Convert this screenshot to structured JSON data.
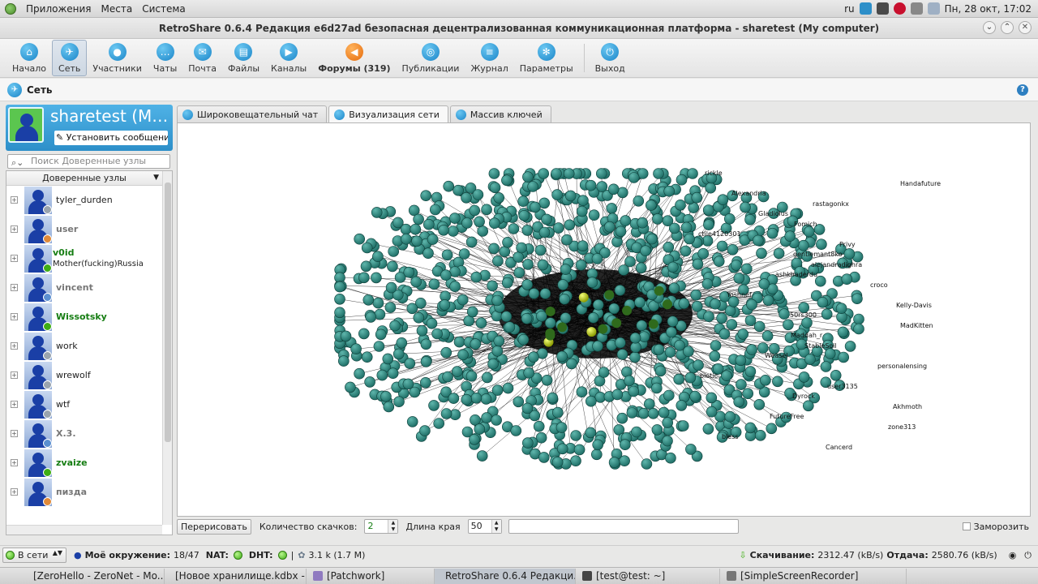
{
  "panel": {
    "menus": [
      "Приложения",
      "Места",
      "Система"
    ],
    "lang": "ru",
    "datetime": "Пн, 28 окт, 17:02"
  },
  "window": {
    "title": "RetroShare 0.6.4 Редакция e6d27ad безопасная децентрализованная коммуникационная платформа - sharetest (My computer)"
  },
  "toolbar": {
    "items": [
      {
        "label": "Начало",
        "icon": "home-icon"
      },
      {
        "label": "Сеть",
        "icon": "network-icon",
        "active": true
      },
      {
        "label": "Участники",
        "icon": "people-icon"
      },
      {
        "label": "Чаты",
        "icon": "chat-icon"
      },
      {
        "label": "Почта",
        "icon": "mail-icon"
      },
      {
        "label": "Файлы",
        "icon": "files-icon"
      },
      {
        "label": "Каналы",
        "icon": "channels-icon"
      },
      {
        "label": "Форумы (319)",
        "icon": "forums-icon",
        "bold": true
      },
      {
        "label": "Публикации",
        "icon": "posted-icon"
      },
      {
        "label": "Журнал",
        "icon": "log-icon"
      },
      {
        "label": "Параметры",
        "icon": "settings-icon"
      },
      {
        "label": "Выход",
        "icon": "power-icon"
      }
    ]
  },
  "page": {
    "title": "Сеть",
    "help": "?"
  },
  "profile": {
    "name": "sharetest (M…",
    "status_placeholder": "Установить сообщение с"
  },
  "search": {
    "placeholder": "Поиск Доверенные узлы"
  },
  "nodes": {
    "header": "Доверенные узлы",
    "items": [
      {
        "name": "tyler_durden",
        "state": "plain",
        "badge": "#9aa4ae"
      },
      {
        "name": "user",
        "state": "offline",
        "badge": "#e08a3a"
      },
      {
        "name": "v0id",
        "sub": "Mother(fucking)Russia",
        "state": "online",
        "badge": "#3fae15"
      },
      {
        "name": "vincent",
        "state": "offline",
        "badge": "#5a8fd0"
      },
      {
        "name": "Wissotsky",
        "state": "online",
        "badge": "#3fae15"
      },
      {
        "name": "work",
        "state": "plain",
        "badge": "#9aa4ae"
      },
      {
        "name": "wrewolf",
        "state": "plain",
        "badge": "#9aa4ae"
      },
      {
        "name": "wtf",
        "state": "plain",
        "badge": "#9aa4ae"
      },
      {
        "name": "X.3.",
        "state": "offline",
        "badge": "#5a8fd0"
      },
      {
        "name": "zvaize",
        "state": "online",
        "badge": "#3fae15"
      },
      {
        "name": "пизда",
        "state": "offline",
        "badge": "#e08a3a"
      }
    ]
  },
  "tabs": [
    {
      "label": "Широковещательный чат",
      "active": false
    },
    {
      "label": "Визуализация сети",
      "active": true
    },
    {
      "label": "Массив ключей",
      "active": false
    }
  ],
  "graph_labels": [
    "rickle",
    "Handafuture",
    "Alexandria",
    "rastagonkx",
    "Gladiolus",
    "Fomich",
    "ctile4120301",
    "Privy",
    "gentlemant8ko",
    "alejandradighra",
    "ashkhaderdu",
    "croco",
    "Yoshnef",
    "Kelly-Davis",
    "50rs300",
    "MadKitten",
    "Maddah_r",
    "StableSoil",
    "Weasel",
    "personalensing",
    "biotic",
    "user3135",
    "Dyrock",
    "Akhmoth",
    "FutureFree",
    "zone313",
    "bless",
    "Cancerd"
  ],
  "controls": {
    "redraw": "Перерисовать",
    "hops_label": "Количество скачков:",
    "hops_value": "2",
    "edge_label": "Длина края",
    "edge_value": "50",
    "freeze": "Заморозить"
  },
  "status": {
    "net_state": "В сети",
    "neighborhood_label": "Моё окружение:",
    "neighborhood_value": "18/47",
    "nat_label": "NAT:",
    "dht_label": "DHT:",
    "dht_peers": "3.1 k (1.7 M)",
    "download_label": "Скачивание:",
    "download_value": "2312.47 (kB/s)",
    "upload_label": "Отдача:",
    "upload_value": "2580.76 (kB/s)"
  },
  "taskbar": [
    {
      "label": "[ZeroHello - ZeroNet - Mo...",
      "color": "#e07a3a"
    },
    {
      "label": "[Новое хранилище.kdbx - ...",
      "color": "#6aa84f"
    },
    {
      "label": "[Patchwork]",
      "color": "#8f7ac0"
    },
    {
      "label": "RetroShare 0.6.4 Редакци...",
      "color": "#2d8fc9",
      "active": true
    },
    {
      "label": "[test@test: ~]",
      "color": "#444"
    },
    {
      "label": "[SimpleScreenRecorder]",
      "color": "#777"
    }
  ],
  "colors": {
    "node_fill": "#1f6f67",
    "node_highlight": "#c8d800",
    "online": "#157d12",
    "accent": "#2d8fc9"
  }
}
